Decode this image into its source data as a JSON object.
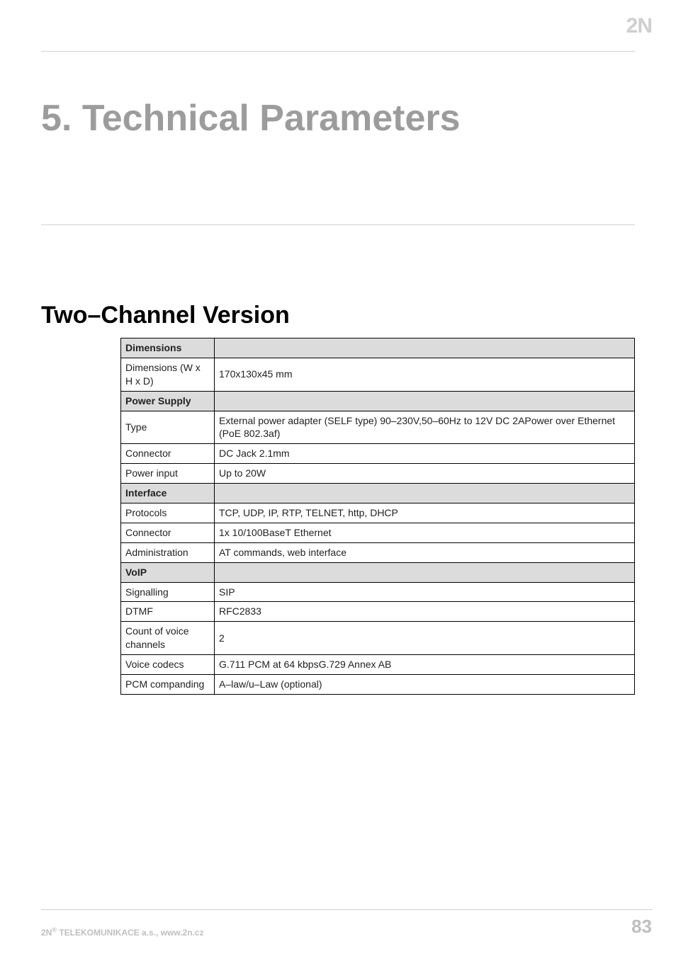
{
  "logo_text": "2N",
  "chapter_title": "5. Technical Parameters",
  "section_title": "Two–Channel Version",
  "groups": [
    {
      "header": "Dimensions",
      "rows": [
        {
          "key": "Dimensions (W x H x D)",
          "value": "170x130x45 mm"
        }
      ]
    },
    {
      "header": "Power Supply",
      "rows": [
        {
          "key": "Type",
          "value": "External power adapter (SELF type) 90–230V,50–60Hz to 12V DC 2APower over Ethernet (PoE 802.3af)"
        },
        {
          "key": "Connector",
          "value": "DC Jack 2.1mm"
        },
        {
          "key": "Power input",
          "value": "Up to 20W"
        }
      ]
    },
    {
      "header": "Interface",
      "rows": [
        {
          "key": "Protocols",
          "value": "TCP, UDP, IP, RTP, TELNET, http, DHCP"
        },
        {
          "key": "Connector",
          "value": "1x 10/100BaseT Ethernet"
        },
        {
          "key": "Administration",
          "value": "AT commands, web interface"
        }
      ]
    },
    {
      "header": "VoIP",
      "rows": [
        {
          "key": "Signalling",
          "value": "SIP"
        },
        {
          "key": "DTMF",
          "value": "RFC2833"
        },
        {
          "key": "Count of voice channels",
          "value": "2"
        },
        {
          "key": "Voice codecs",
          "value": "G.711 PCM at 64 kbpsG.729 Annex AB"
        },
        {
          "key": "PCM companding",
          "value": "A–law/u–Law (optional)"
        }
      ]
    }
  ],
  "footer": {
    "brand": "2N",
    "reg": "®",
    "company": " TELEKOMUNIKACE a.s., www.2n.cz",
    "page_number": "83"
  }
}
